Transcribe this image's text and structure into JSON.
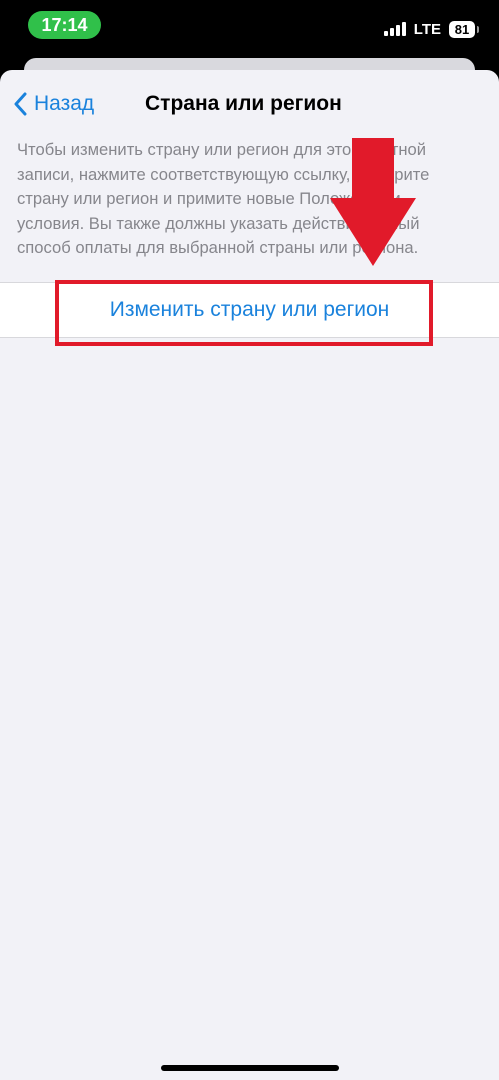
{
  "status_bar": {
    "time": "17:14",
    "network": "LTE",
    "battery": "81"
  },
  "nav": {
    "back_label": "Назад",
    "title": "Страна или регион"
  },
  "description": "Чтобы изменить страну или регион для этой учетной записи, нажмите соответствующую ссылку, выберите страну или регион и примите новые Положения и условия. Вы также должны указать действительный способ оплаты для выбранной страны или региона.",
  "action": {
    "label": "Изменить страну или регион"
  },
  "colors": {
    "accent": "#1a82dc",
    "annotation": "#e11a2a",
    "time_pill": "#30c04a",
    "background": "#f2f2f7"
  },
  "icons": {
    "back": "chevron-left-icon",
    "signal": "signal-icon",
    "battery": "battery-icon",
    "annotation_arrow": "arrow-down-icon"
  }
}
